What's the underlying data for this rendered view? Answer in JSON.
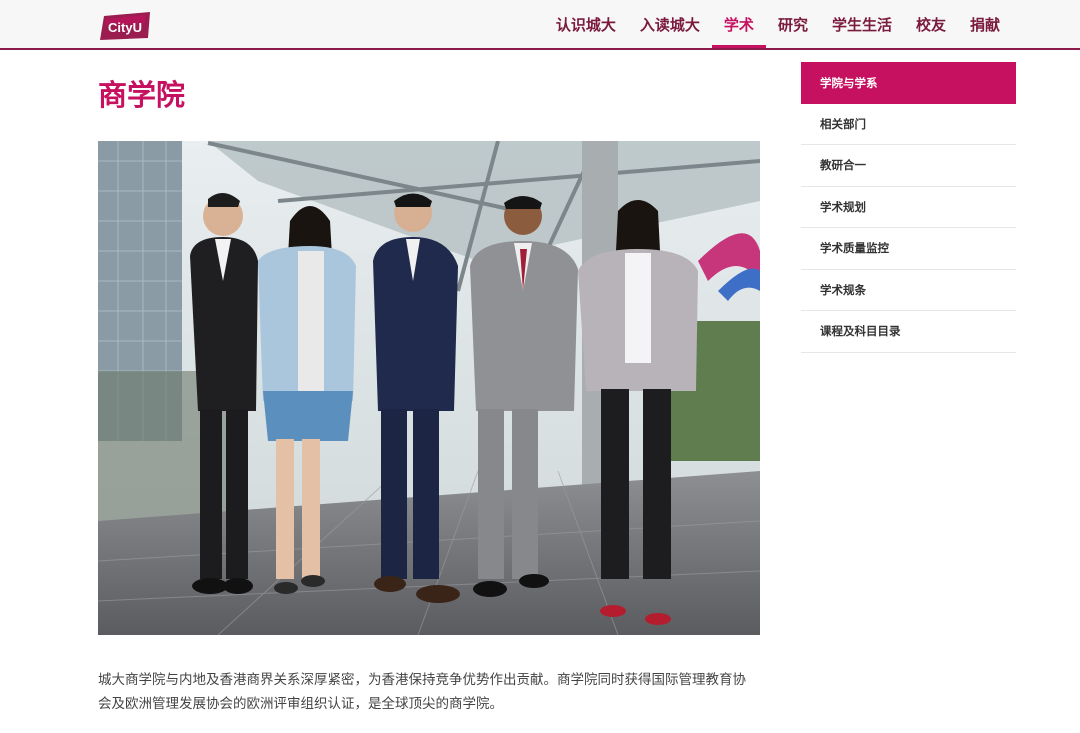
{
  "header": {
    "logo_text": "CityU",
    "nav": [
      {
        "label": "认识城大",
        "active": false
      },
      {
        "label": "入读城大",
        "active": false
      },
      {
        "label": "学术",
        "active": true
      },
      {
        "label": "研究",
        "active": false
      },
      {
        "label": "学生生活",
        "active": false
      },
      {
        "label": "校友",
        "active": false
      },
      {
        "label": "捐献",
        "active": false
      }
    ]
  },
  "main": {
    "title": "商学院",
    "hero_alt": "城大商学院学生合照",
    "paragraph": "城大商学院与内地及香港商界关系深厚紧密，为香港保持竞争优势作出贡献。商学院同时获得国际管理教育协会及欧洲管理发展协会的欧洲评审组织认证，是全球顶尖的商学院。"
  },
  "sidebar": {
    "items": [
      {
        "label": "学院与学系",
        "active": true
      },
      {
        "label": "相关部门",
        "active": false
      },
      {
        "label": "教研合一",
        "active": false
      },
      {
        "label": "学术规划",
        "active": false
      },
      {
        "label": "学术质量监控",
        "active": false
      },
      {
        "label": "学术规条",
        "active": false
      },
      {
        "label": "课程及科目目录",
        "active": false
      }
    ]
  },
  "colors": {
    "brand": "#c5115f",
    "nav_text": "#7a1a3d"
  }
}
